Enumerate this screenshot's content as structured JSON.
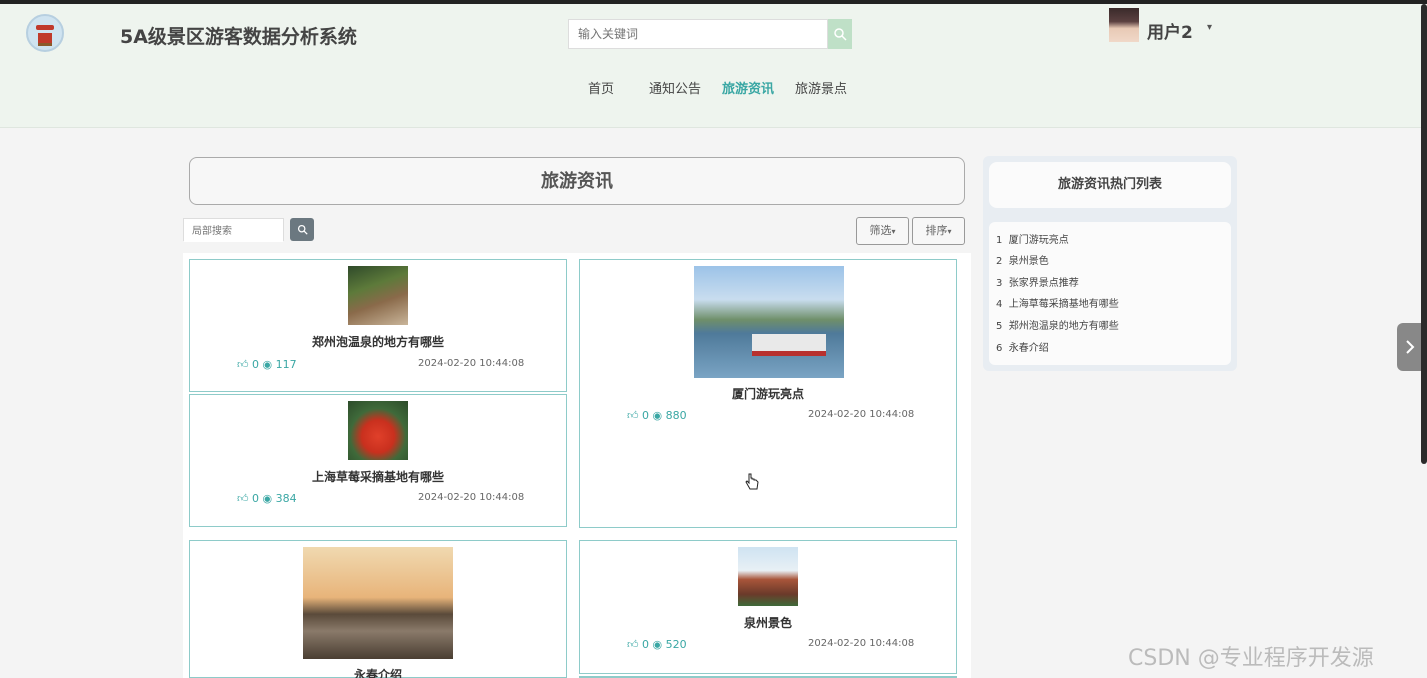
{
  "header": {
    "site_title": "5A级景区游客数据分析系统",
    "search_placeholder": "输入关键词",
    "username": "用户2",
    "user_caret": "▾"
  },
  "nav": [
    {
      "label": "首页"
    },
    {
      "label": "通知公告"
    },
    {
      "label": "旅游资讯",
      "active": true
    },
    {
      "label": "旅游景点"
    }
  ],
  "page": {
    "title": "旅游资讯",
    "local_search_placeholder": "局部搜索",
    "filter_label": "筛选",
    "sort_label": "排序",
    "caret": "▾"
  },
  "cards": [
    {
      "title": "郑州泡温泉的地方有哪些",
      "likes": "0",
      "views": "117",
      "date": "2024-02-20 10:44:08"
    },
    {
      "title": "上海草莓采摘基地有哪些",
      "likes": "0",
      "views": "384",
      "date": "2024-02-20 10:44:08"
    },
    {
      "title": "厦门游玩亮点",
      "likes": "0",
      "views": "880",
      "date": "2024-02-20 10:44:08"
    },
    {
      "title": "永春介绍",
      "likes": "",
      "views": "",
      "date": ""
    },
    {
      "title": "泉州景色",
      "likes": "0",
      "views": "520",
      "date": "2024-02-20 10:44:08"
    }
  ],
  "hot": {
    "title": "旅游资讯热门列表",
    "items": [
      {
        "rank": "1",
        "label": "厦门游玩亮点"
      },
      {
        "rank": "2",
        "label": "泉州景色"
      },
      {
        "rank": "3",
        "label": "张家界景点推荐"
      },
      {
        "rank": "4",
        "label": "上海草莓采摘基地有哪些"
      },
      {
        "rank": "5",
        "label": "郑州泡温泉的地方有哪些"
      },
      {
        "rank": "6",
        "label": "永春介绍"
      }
    ]
  },
  "watermark": "CSDN @专业程序开发源",
  "colors": {
    "accent": "#3aa7a4",
    "card_border": "#8ecbc9",
    "header_bg": "#eef4ee"
  },
  "icons": [
    "logo-icon",
    "search-icon",
    "chevron-down-icon",
    "thumb-up-icon",
    "eye-icon",
    "chevron-right-icon",
    "hand-cursor-icon"
  ]
}
